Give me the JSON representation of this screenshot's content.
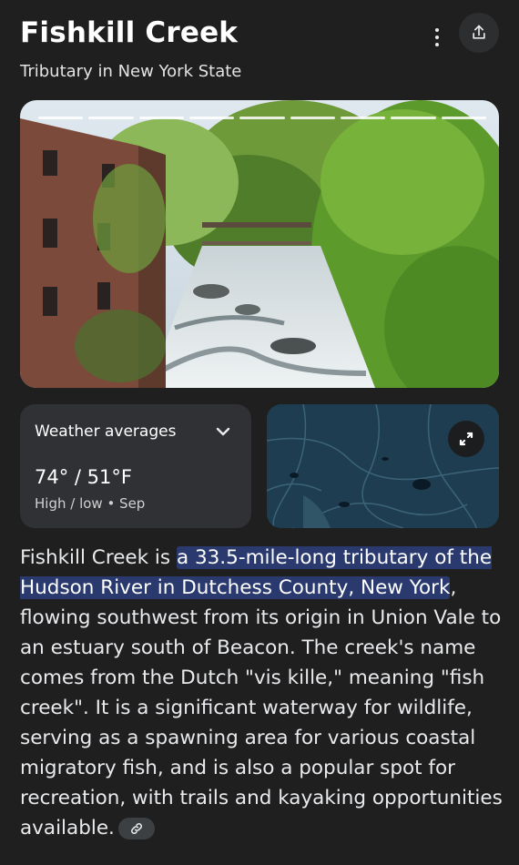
{
  "header": {
    "title": "Fishkill Creek",
    "subtitle": "Tributary in New York State",
    "more_icon": "more-vert-icon",
    "share_icon": "share-icon"
  },
  "photo": {
    "segments": 9,
    "accent": "#ffffff"
  },
  "weather": {
    "label": "Weather averages",
    "temp": "74° / 51°F",
    "sub": "High / low • Sep",
    "chevron_icon": "chevron-down-icon"
  },
  "map": {
    "expand_icon": "expand-icon",
    "water_color": "#1e3a4c"
  },
  "description": {
    "before": "Fishkill Creek is ",
    "highlight": "a 33.5-mile-long tributary of the Hudson River in Dutchess County, New York",
    "after": ", flowing southwest from its origin in Union Vale to an estuary south of Beacon. The creek's name comes from the Dutch \"vis kille,\" meaning \"fish creek\". It is a significant waterway for wildlife, serving as a spawning area for various coastal migratory fish, and is also a popular spot for recreation, with trails and kayaking opportunities available.",
    "link_icon": "link-icon"
  },
  "colors": {
    "background": "#1f1f1f",
    "card": "#303134",
    "highlight": "#2a3a6e"
  }
}
